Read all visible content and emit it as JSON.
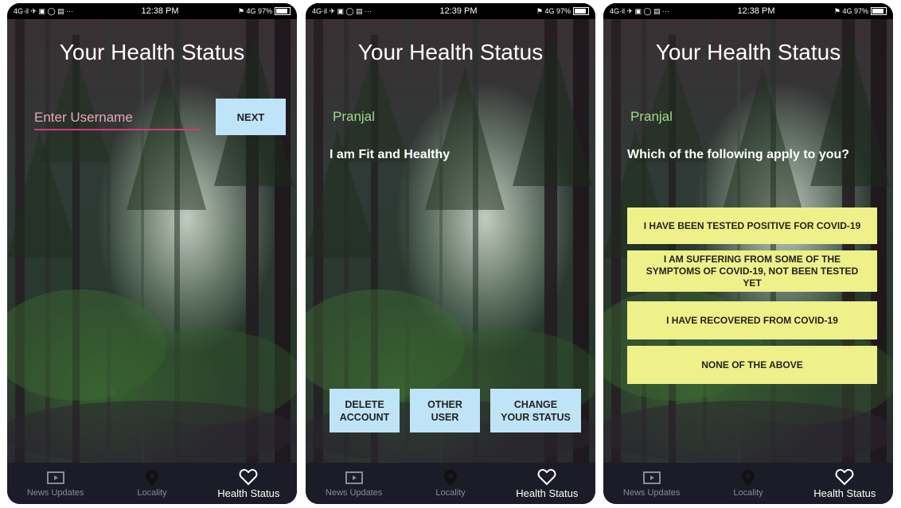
{
  "screens": [
    {
      "status_bar": {
        "left": "4G·il ✈ ▣ ◯ ▤ ···",
        "time": "12:38 PM",
        "right": "⚑ 4G 97%"
      },
      "title": "Your Health Status",
      "username_placeholder": "Enter Username",
      "next_label": "NEXT"
    },
    {
      "status_bar": {
        "left": "4G·il ✈ ▣ ◯ ▤ ···",
        "time": "12:39 PM",
        "right": "⚑ 4G 97%"
      },
      "title": "Your Health Status",
      "user_name": "Pranjal",
      "status_text": "I am Fit and Healthy",
      "buttons": {
        "delete_line1": "DELETE",
        "delete_line2": "ACCOUNT",
        "other_line1": "OTHER",
        "other_line2": "USER",
        "change_line1": "CHANGE",
        "change_line2": "YOUR STATUS"
      }
    },
    {
      "status_bar": {
        "left": "4G·il ✈ ▣ ◯ ▤ ···",
        "time": "12:38 PM",
        "right": "⚑ 4G 97%"
      },
      "title": "Your Health Status",
      "user_name": "Pranjal",
      "question": "Which of the following apply to you?",
      "options": [
        {
          "label": "I HAVE BEEN TESTED POSITIVE FOR COVID-19"
        },
        {
          "line1": "I AM SUFFERING FROM SOME OF THE",
          "line2": "SYMPTOMS OF COVID-19, NOT BEEN TESTED",
          "line3": "YET"
        },
        {
          "label": "I HAVE RECOVERED FROM COVID-19"
        },
        {
          "label": "NONE OF THE ABOVE"
        }
      ]
    }
  ],
  "nav": {
    "news": "News Updates",
    "locality": "Locality",
    "health": "Health Status",
    "icons": [
      "play-icon",
      "location-pin-icon",
      "heart-icon"
    ]
  },
  "colors": {
    "button_blue": "#bfe4f7",
    "button_yellow": "#eef08a",
    "accent_pink": "#d63a78",
    "name_green": "#9fdc88",
    "nav_bg": "#1c1c28"
  }
}
